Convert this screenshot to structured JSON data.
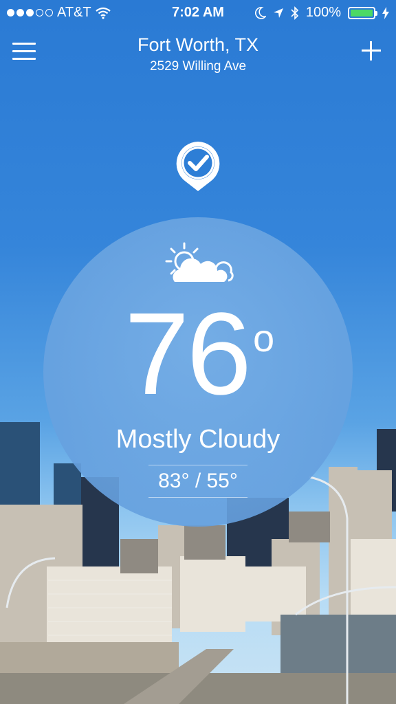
{
  "status_bar": {
    "carrier": "AT&T",
    "time": "7:02 AM",
    "battery": "100%",
    "signal_bars": 3,
    "signal_total": 5
  },
  "header": {
    "city": "Fort Worth, TX",
    "address": "2529 Willing Ave"
  },
  "weather": {
    "temperature": "76",
    "degree_symbol": "o",
    "condition": "Mostly Cloudy",
    "high_low": "83° / 55°",
    "icon": "partly-cloudy-icon"
  },
  "icons": {
    "menu": "hamburger-menu-icon",
    "add": "plus-icon",
    "location": "location-check-pin-icon",
    "wifi": "wifi-icon",
    "moon": "moon-icon",
    "location_arrow": "location-arrow-icon",
    "bluetooth": "bluetooth-icon",
    "battery": "battery-icon"
  },
  "colors": {
    "sky_top": "#2a7ad4",
    "battery_fill": "#4cd964",
    "text": "#ffffff"
  }
}
